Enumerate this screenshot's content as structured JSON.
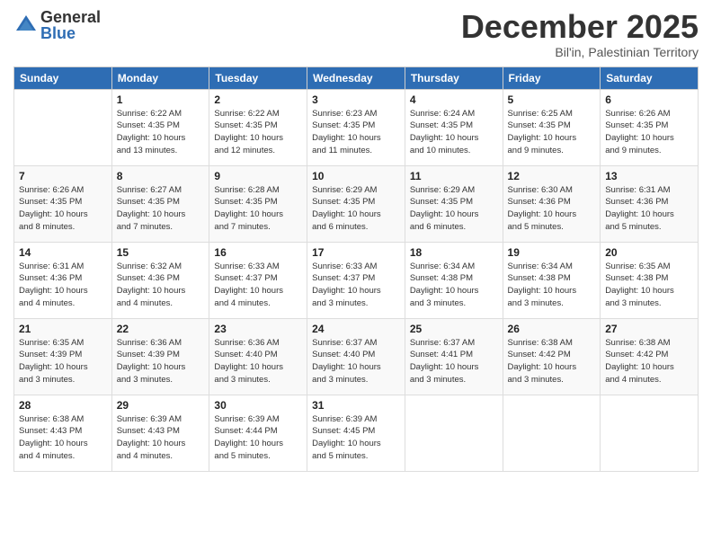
{
  "logo": {
    "general": "General",
    "blue": "Blue"
  },
  "title": "December 2025",
  "subtitle": "Bil'in, Palestinian Territory",
  "weekdays": [
    "Sunday",
    "Monday",
    "Tuesday",
    "Wednesday",
    "Thursday",
    "Friday",
    "Saturday"
  ],
  "weeks": [
    [
      {
        "day": "",
        "info": ""
      },
      {
        "day": "1",
        "info": "Sunrise: 6:22 AM\nSunset: 4:35 PM\nDaylight: 10 hours\nand 13 minutes."
      },
      {
        "day": "2",
        "info": "Sunrise: 6:22 AM\nSunset: 4:35 PM\nDaylight: 10 hours\nand 12 minutes."
      },
      {
        "day": "3",
        "info": "Sunrise: 6:23 AM\nSunset: 4:35 PM\nDaylight: 10 hours\nand 11 minutes."
      },
      {
        "day": "4",
        "info": "Sunrise: 6:24 AM\nSunset: 4:35 PM\nDaylight: 10 hours\nand 10 minutes."
      },
      {
        "day": "5",
        "info": "Sunrise: 6:25 AM\nSunset: 4:35 PM\nDaylight: 10 hours\nand 9 minutes."
      },
      {
        "day": "6",
        "info": "Sunrise: 6:26 AM\nSunset: 4:35 PM\nDaylight: 10 hours\nand 9 minutes."
      }
    ],
    [
      {
        "day": "7",
        "info": "Sunrise: 6:26 AM\nSunset: 4:35 PM\nDaylight: 10 hours\nand 8 minutes."
      },
      {
        "day": "8",
        "info": "Sunrise: 6:27 AM\nSunset: 4:35 PM\nDaylight: 10 hours\nand 7 minutes."
      },
      {
        "day": "9",
        "info": "Sunrise: 6:28 AM\nSunset: 4:35 PM\nDaylight: 10 hours\nand 7 minutes."
      },
      {
        "day": "10",
        "info": "Sunrise: 6:29 AM\nSunset: 4:35 PM\nDaylight: 10 hours\nand 6 minutes."
      },
      {
        "day": "11",
        "info": "Sunrise: 6:29 AM\nSunset: 4:35 PM\nDaylight: 10 hours\nand 6 minutes."
      },
      {
        "day": "12",
        "info": "Sunrise: 6:30 AM\nSunset: 4:36 PM\nDaylight: 10 hours\nand 5 minutes."
      },
      {
        "day": "13",
        "info": "Sunrise: 6:31 AM\nSunset: 4:36 PM\nDaylight: 10 hours\nand 5 minutes."
      }
    ],
    [
      {
        "day": "14",
        "info": "Sunrise: 6:31 AM\nSunset: 4:36 PM\nDaylight: 10 hours\nand 4 minutes."
      },
      {
        "day": "15",
        "info": "Sunrise: 6:32 AM\nSunset: 4:36 PM\nDaylight: 10 hours\nand 4 minutes."
      },
      {
        "day": "16",
        "info": "Sunrise: 6:33 AM\nSunset: 4:37 PM\nDaylight: 10 hours\nand 4 minutes."
      },
      {
        "day": "17",
        "info": "Sunrise: 6:33 AM\nSunset: 4:37 PM\nDaylight: 10 hours\nand 3 minutes."
      },
      {
        "day": "18",
        "info": "Sunrise: 6:34 AM\nSunset: 4:38 PM\nDaylight: 10 hours\nand 3 minutes."
      },
      {
        "day": "19",
        "info": "Sunrise: 6:34 AM\nSunset: 4:38 PM\nDaylight: 10 hours\nand 3 minutes."
      },
      {
        "day": "20",
        "info": "Sunrise: 6:35 AM\nSunset: 4:38 PM\nDaylight: 10 hours\nand 3 minutes."
      }
    ],
    [
      {
        "day": "21",
        "info": "Sunrise: 6:35 AM\nSunset: 4:39 PM\nDaylight: 10 hours\nand 3 minutes."
      },
      {
        "day": "22",
        "info": "Sunrise: 6:36 AM\nSunset: 4:39 PM\nDaylight: 10 hours\nand 3 minutes."
      },
      {
        "day": "23",
        "info": "Sunrise: 6:36 AM\nSunset: 4:40 PM\nDaylight: 10 hours\nand 3 minutes."
      },
      {
        "day": "24",
        "info": "Sunrise: 6:37 AM\nSunset: 4:40 PM\nDaylight: 10 hours\nand 3 minutes."
      },
      {
        "day": "25",
        "info": "Sunrise: 6:37 AM\nSunset: 4:41 PM\nDaylight: 10 hours\nand 3 minutes."
      },
      {
        "day": "26",
        "info": "Sunrise: 6:38 AM\nSunset: 4:42 PM\nDaylight: 10 hours\nand 3 minutes."
      },
      {
        "day": "27",
        "info": "Sunrise: 6:38 AM\nSunset: 4:42 PM\nDaylight: 10 hours\nand 4 minutes."
      }
    ],
    [
      {
        "day": "28",
        "info": "Sunrise: 6:38 AM\nSunset: 4:43 PM\nDaylight: 10 hours\nand 4 minutes."
      },
      {
        "day": "29",
        "info": "Sunrise: 6:39 AM\nSunset: 4:43 PM\nDaylight: 10 hours\nand 4 minutes."
      },
      {
        "day": "30",
        "info": "Sunrise: 6:39 AM\nSunset: 4:44 PM\nDaylight: 10 hours\nand 5 minutes."
      },
      {
        "day": "31",
        "info": "Sunrise: 6:39 AM\nSunset: 4:45 PM\nDaylight: 10 hours\nand 5 minutes."
      },
      {
        "day": "",
        "info": ""
      },
      {
        "day": "",
        "info": ""
      },
      {
        "day": "",
        "info": ""
      }
    ]
  ]
}
